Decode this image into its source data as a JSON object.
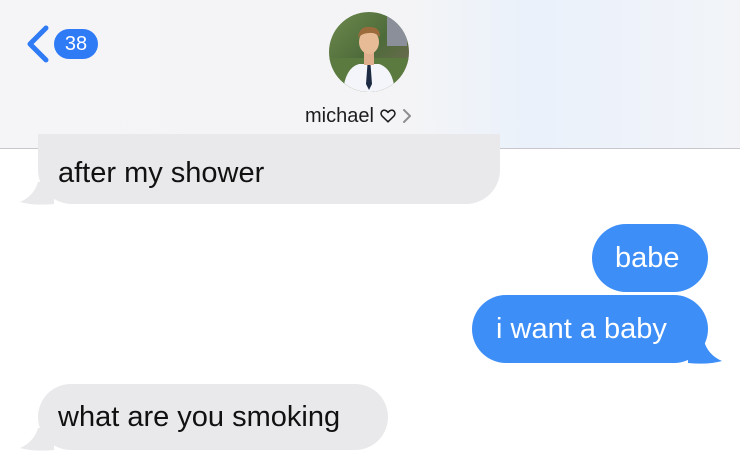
{
  "header": {
    "back_count": "38",
    "contact_name": "michael",
    "heart": "heart-outline-icon",
    "chevron": "chevron-right-icon"
  },
  "messages": [
    {
      "direction": "received",
      "text": "after my shower"
    },
    {
      "direction": "sent",
      "text": "babe"
    },
    {
      "direction": "sent",
      "text": "i want a baby"
    },
    {
      "direction": "received",
      "text": "what are you smoking"
    }
  ],
  "colors": {
    "sent_bubble": "#3d8ef7",
    "received_bubble": "#e9e9eb",
    "accent": "#2f7bf6"
  }
}
